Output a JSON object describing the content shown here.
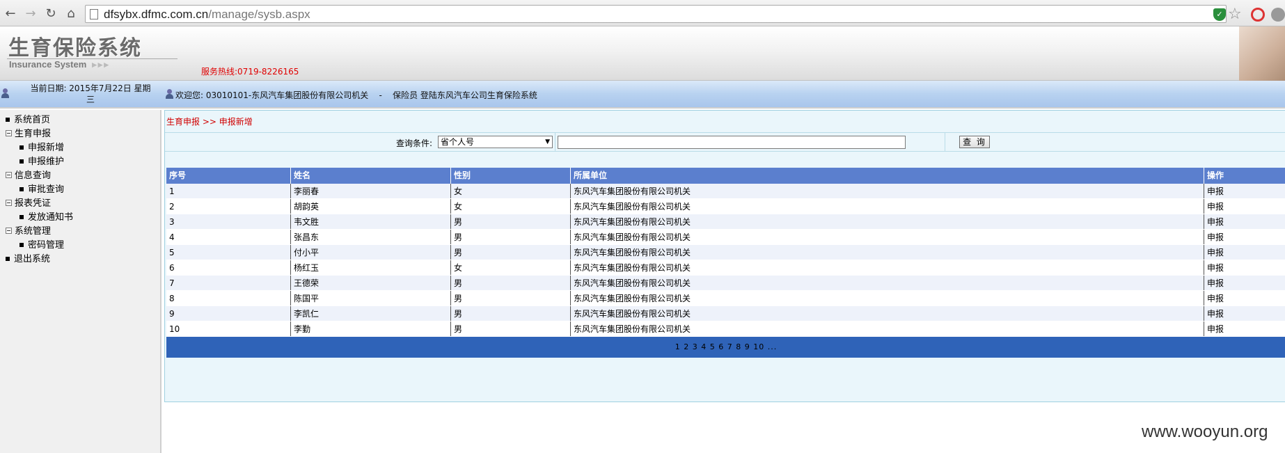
{
  "browser": {
    "url_host": "dfsybx.dfmc.com.cn",
    "url_path": "/manage/sysb.aspx",
    "nav_back": "←",
    "nav_forward": "→",
    "nav_reload": "↻",
    "nav_home": "⌂"
  },
  "header": {
    "title": "生育保险系统",
    "subtitle": "Insurance System",
    "subtitle_arrows": "▸▸▸",
    "hotline": "服务热线:0719-8226165"
  },
  "info_bar": {
    "date_line1": "当前日期: 2015年7月22日  星期",
    "date_line2": "三",
    "welcome": "欢迎您: 03010101-东风汽车集团股份有限公司机关    -    保险员 登陆东风汽车公司生育保险系统"
  },
  "sidebar": {
    "items": [
      {
        "label": "系统首页",
        "kind": "top-leaf"
      },
      {
        "label": "生育申报",
        "kind": "group"
      },
      {
        "label": "申报新增",
        "kind": "child"
      },
      {
        "label": "申报维护",
        "kind": "child"
      },
      {
        "label": "信息查询",
        "kind": "group"
      },
      {
        "label": "审批查询",
        "kind": "child"
      },
      {
        "label": "报表凭证",
        "kind": "group"
      },
      {
        "label": "发放通知书",
        "kind": "child"
      },
      {
        "label": "系统管理",
        "kind": "group"
      },
      {
        "label": "密码管理",
        "kind": "child"
      },
      {
        "label": "退出系统",
        "kind": "top-leaf"
      }
    ]
  },
  "main": {
    "breadcrumb": "生育申报 >> 申报新增",
    "query": {
      "label": "查询条件:",
      "select_value": "省个人号",
      "input_value": "",
      "button_label": "查 询"
    },
    "table": {
      "headers": [
        "序号",
        "姓名",
        "性别",
        "所属单位",
        "操作"
      ],
      "rows": [
        [
          "1",
          "李丽春",
          "女",
          "东风汽车集团股份有限公司机关",
          "申报"
        ],
        [
          "2",
          "胡韵英",
          "女",
          "东风汽车集团股份有限公司机关",
          "申报"
        ],
        [
          "3",
          "韦文胜",
          "男",
          "东风汽车集团股份有限公司机关",
          "申报"
        ],
        [
          "4",
          "张昌东",
          "男",
          "东风汽车集团股份有限公司机关",
          "申报"
        ],
        [
          "5",
          "付小平",
          "男",
          "东风汽车集团股份有限公司机关",
          "申报"
        ],
        [
          "6",
          "杨红玉",
          "女",
          "东风汽车集团股份有限公司机关",
          "申报"
        ],
        [
          "7",
          "王德荣",
          "男",
          "东风汽车集团股份有限公司机关",
          "申报"
        ],
        [
          "8",
          "陈国平",
          "男",
          "东风汽车集团股份有限公司机关",
          "申报"
        ],
        [
          "9",
          "李凯仁",
          "男",
          "东风汽车集团股份有限公司机关",
          "申报"
        ],
        [
          "10",
          "李勤",
          "男",
          "东风汽车集团股份有限公司机关",
          "申报"
        ]
      ]
    },
    "pager": "1 2 3 4 5 6 7 8 9 10 ..."
  },
  "watermark": "www.wooyun.org",
  "colors": {
    "grid_header": "#5b7fce",
    "pager": "#2f63b8",
    "breadcrumb": "#d00000",
    "hotline": "#e00000"
  }
}
